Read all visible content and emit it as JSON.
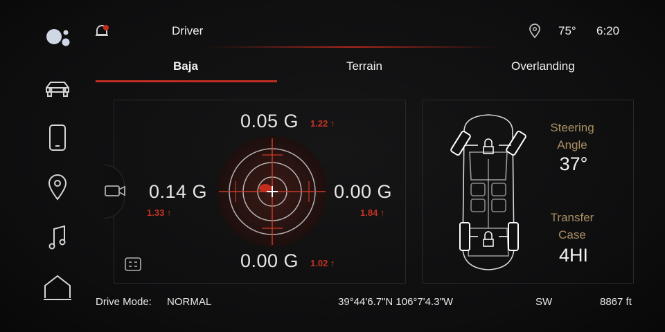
{
  "topbar": {
    "profile": "Driver",
    "temperature": "75°",
    "time": "6:20"
  },
  "tabs": [
    {
      "label": "Baja",
      "active": true
    },
    {
      "label": "Terrain",
      "active": false
    },
    {
      "label": "Overlanding",
      "active": false
    }
  ],
  "gforce": {
    "top": {
      "value": "0.05 G",
      "peak": "1.22 ↑"
    },
    "left": {
      "value": "0.14 G",
      "peak": "1.33 ↑"
    },
    "right": {
      "value": "0.00 G",
      "peak": "1.84 ↑"
    },
    "bottom": {
      "value": "0.00 G",
      "peak": "1.02 ↑"
    }
  },
  "vehicle_info": {
    "steering_label_1": "Steering",
    "steering_label_2": "Angle",
    "steering_value": "37°",
    "transfer_label_1": "Transfer",
    "transfer_label_2": "Case",
    "transfer_value": "4HI"
  },
  "bottom_bar": {
    "drive_mode_label": "Drive Mode:",
    "drive_mode_value": "NORMAL",
    "coordinates": "39°44'6.7\"N 106°7'4.3\"W",
    "heading": "SW",
    "altitude": "8867 ft"
  },
  "colors": {
    "accent": "#c12d20",
    "label_gold": "#a98e62",
    "peak_red": "#c63222"
  },
  "icons": [
    "assistant-icon",
    "vehicle-icon",
    "phone-icon",
    "navigation-icon",
    "music-icon",
    "home-icon",
    "notification-icon",
    "location-pin-icon",
    "camera-icon",
    "tilt-icon"
  ]
}
